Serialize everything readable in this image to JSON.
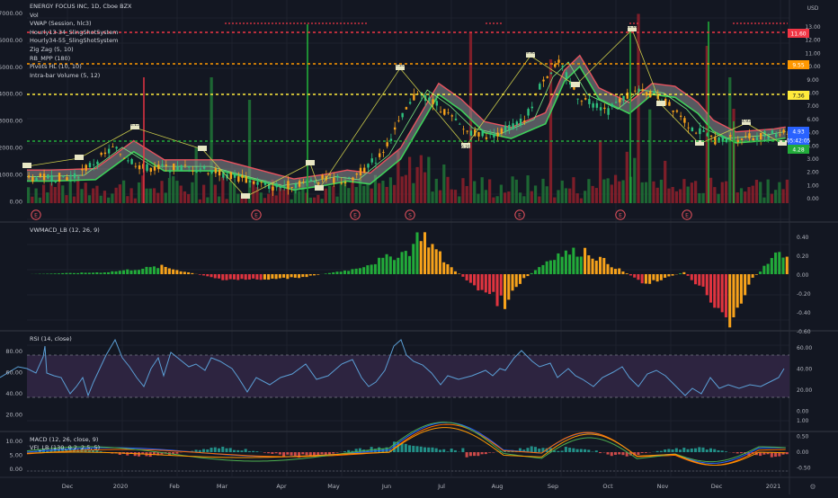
{
  "legend": {
    "title": "ENERGY FOCUS INC, 1D, Cboe BZX",
    "indicators": [
      "Vol",
      "VWAP (Session, hlc3)",
      "Hourly13-34_SlingShotSystem",
      "Hourly34-55_SlingShotSystem",
      "Zig Zag (5, 10)",
      "RB_MPP (180)",
      "Pivots HL (10, 10)",
      "Intra-bar Volume (5, 12)"
    ]
  },
  "price_pane": {
    "right_ticks": [
      "13.00",
      "12.00",
      "11.00",
      "10.00",
      "9.00",
      "8.00",
      "7.00",
      "6.00",
      "5.00",
      "4.00",
      "3.00",
      "2.00",
      "1.00",
      "0.00"
    ],
    "currency": "USD",
    "left_ticks": [
      "7000.00",
      "6000.00",
      "5000.00",
      "4000.00",
      "3000.00",
      "2000.00",
      "1000.00",
      "0.00"
    ],
    "price_tags": [
      {
        "label": "11.60",
        "color": "#f23645"
      },
      {
        "label": "9.55",
        "color": "#ff9800"
      },
      {
        "label": "7.36",
        "color": "#ffeb3b"
      },
      {
        "label": "4.93",
        "color": "#2962ff"
      },
      {
        "label": "05:42:05",
        "color": "#2962ff"
      },
      {
        "label": "4.28",
        "color": "#22ab3a"
      }
    ],
    "pivot_labels": [
      "4.15",
      "7.20",
      "9.90",
      "11.60",
      "6.21",
      "4.93"
    ],
    "event_markers": [
      "E",
      "E",
      "E",
      "S",
      "E",
      "E",
      "E"
    ]
  },
  "vwmacd_pane": {
    "label": "VWMACD_LB (12, 26, 9)",
    "ticks": [
      "0.40",
      "0.20",
      "0.00",
      "-0.20",
      "-0.40",
      "-0.60"
    ]
  },
  "rsi_pane": {
    "label": "RSI (14, close)",
    "left_ticks": [
      "80.00",
      "60.00",
      "40.00",
      "20.00"
    ],
    "right_ticks": [
      "60.00",
      "40.00",
      "20.00",
      "0.00"
    ]
  },
  "macd_pane": {
    "labels": [
      "MACD (12, 26, close, 9)",
      "VFI_LB (130, 0.2, 2.5, 5)"
    ],
    "left_ticks": [
      "10.00",
      "5.00",
      "0.00"
    ],
    "right_ticks": [
      "1.00",
      "0.50",
      "0.00",
      "-0.50"
    ]
  },
  "time_axis": [
    "Dec",
    "2020",
    "Feb",
    "Mar",
    "Apr",
    "May",
    "Jun",
    "Jul",
    "Aug",
    "Sep",
    "Oct",
    "Nov",
    "Dec",
    "2021"
  ],
  "colors": {
    "bg": "#131722",
    "up": "#22ab3a",
    "down": "#f23645",
    "grid": "#1e222d"
  }
}
